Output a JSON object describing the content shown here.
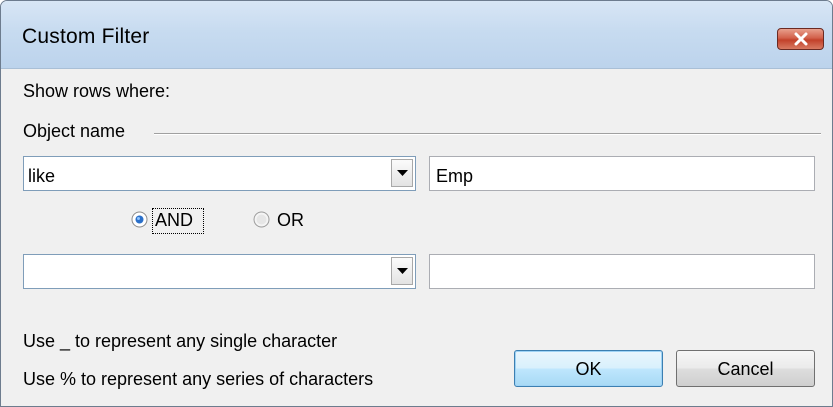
{
  "window": {
    "title": "Custom Filter"
  },
  "dialog": {
    "show_rows_label": "Show rows where:",
    "field_name": "Object name",
    "condition1": {
      "operator": "like",
      "value": "Emp"
    },
    "logic": {
      "and_label": "AND",
      "or_label": "OR",
      "selected": "AND"
    },
    "condition2": {
      "operator": "",
      "value": ""
    },
    "hint_single": "Use _ to represent any single character",
    "hint_series": "Use % to represent any series of characters",
    "ok_label": "OK",
    "cancel_label": "Cancel"
  },
  "colors": {
    "titlebar": "#c7dbf0",
    "close_button": "#c2412a",
    "radio_selected": "#2a6fc9",
    "default_button_border": "#3c7fb1"
  }
}
